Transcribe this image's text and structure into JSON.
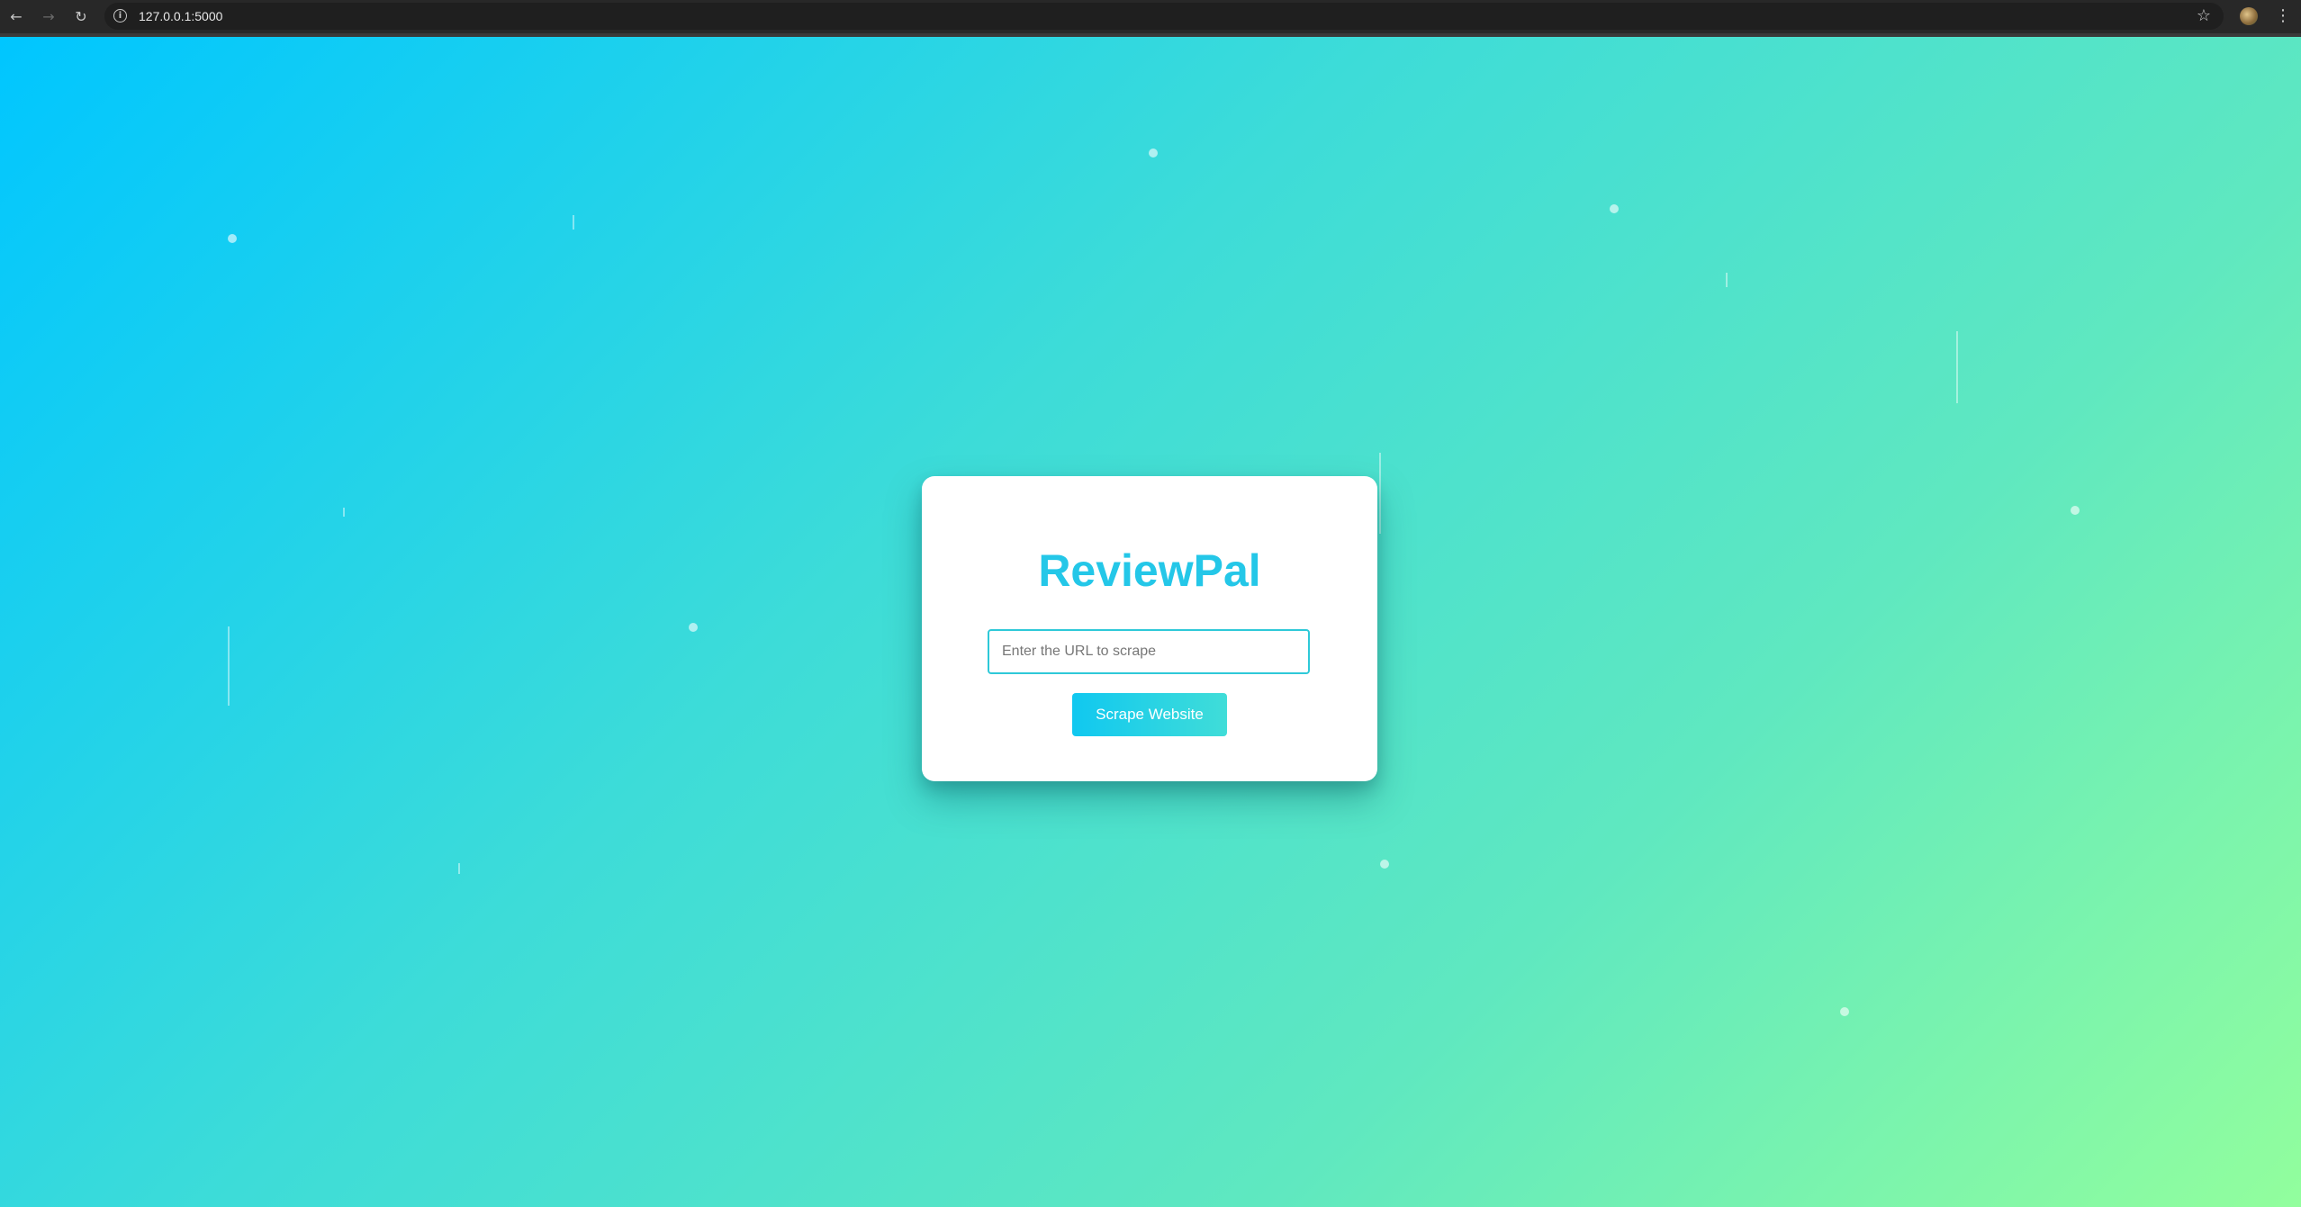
{
  "browser": {
    "url": "127.0.0.1:5000",
    "back_icon": "arrow-left-icon",
    "forward_icon": "arrow-right-icon",
    "reload_icon": "reload-icon",
    "info_icon": "info-icon",
    "bookmark_icon": "star-icon",
    "menu_icon": "kebab-menu-icon"
  },
  "app": {
    "title": "ReviewPal",
    "url_input": {
      "value": "",
      "placeholder": "Enter the URL to scrape"
    },
    "scrape_button_label": "Scrape Website"
  },
  "colors": {
    "accent": "#24c7e8",
    "gradient_start": "#00c6ff",
    "gradient_end": "#92fe9d",
    "input_border": "#2ec9d8"
  }
}
